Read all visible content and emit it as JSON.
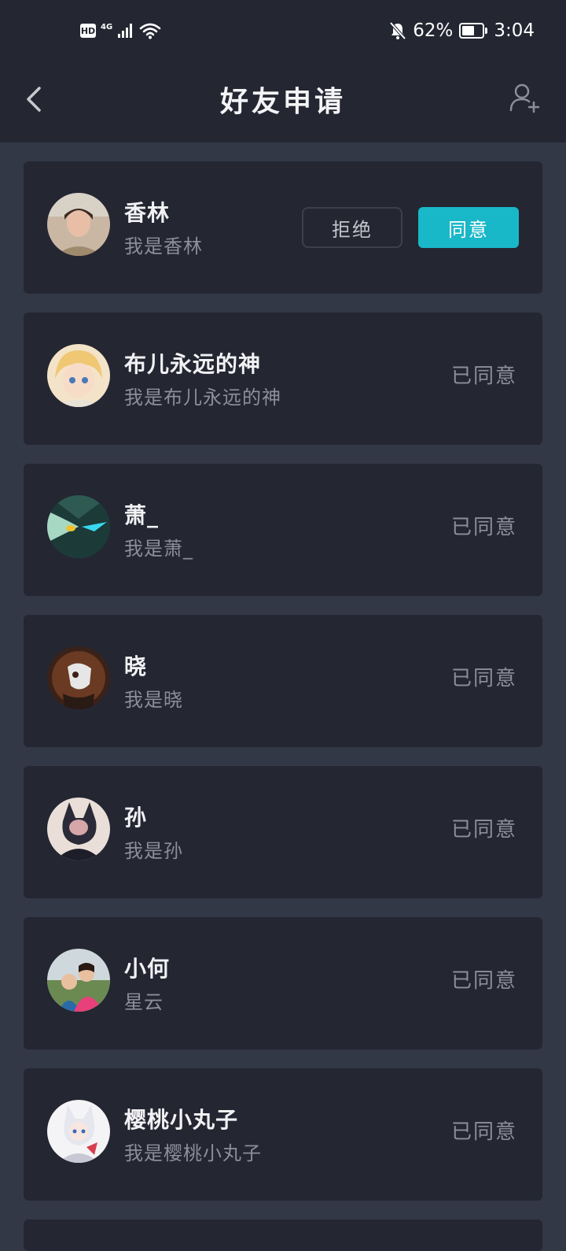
{
  "status_bar": {
    "hd": "HD",
    "network": "4G",
    "battery_percent": "62%",
    "battery_level": 0.62,
    "time": "3:04",
    "icons": [
      "hd-icon",
      "signal-icon",
      "wifi-icon",
      "bell-muted-icon",
      "battery-icon"
    ]
  },
  "header": {
    "title": "好友申请",
    "back_icon": "chevron-left-icon",
    "add_icon": "add-friend-icon"
  },
  "colors": {
    "accent": "#19b8c9",
    "card_bg": "#242632",
    "page_bg": "#333847"
  },
  "requests": [
    {
      "name": "香林",
      "message": "我是香林",
      "status": "",
      "reject_label": "拒绝",
      "accept_label": "同意"
    },
    {
      "name": "布儿永远的神",
      "message": "我是布儿永远的神",
      "status": "已同意"
    },
    {
      "name": "萧_",
      "message": "我是萧_",
      "status": "已同意"
    },
    {
      "name": "晓",
      "message": "我是晓",
      "status": "已同意"
    },
    {
      "name": "孙",
      "message": "我是孙",
      "status": "已同意"
    },
    {
      "name": "小何",
      "message": "星云",
      "status": "已同意"
    },
    {
      "name": "樱桃小丸子",
      "message": "我是樱桃小丸子",
      "status": "已同意"
    }
  ]
}
